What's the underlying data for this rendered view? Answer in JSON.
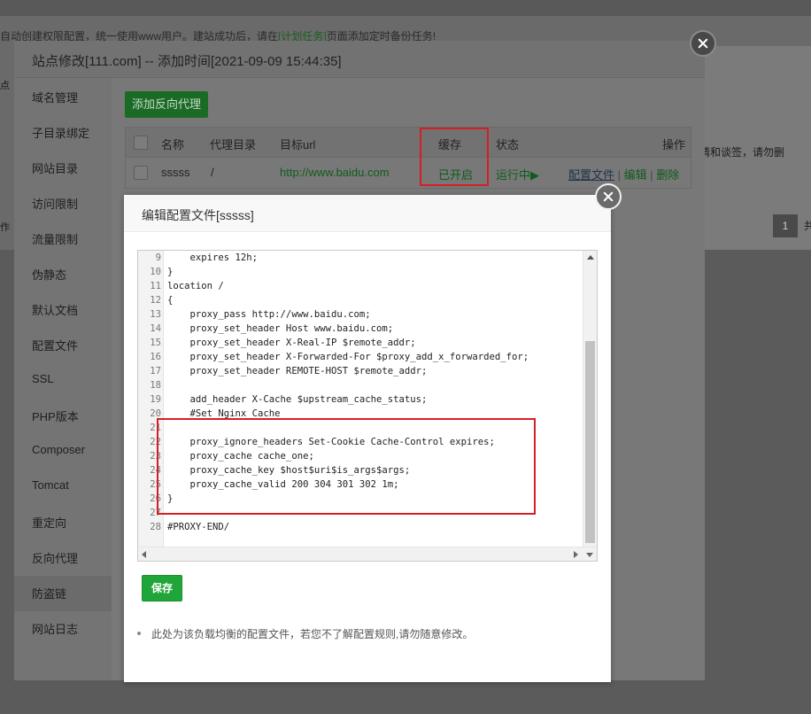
{
  "background": {
    "notice_prefix": "自动创建权限配置，统一使用www用户。建站成功后，请在",
    "notice_link": "[计划任务]",
    "notice_suffix": "页面添加定时备份任务!",
    "left_frag_1": "点",
    "left_frag_2": "作",
    "right_text": "请和谈签，请勿删",
    "page_number": "1",
    "page_total": "共"
  },
  "site_window": {
    "title": "站点修改[111.com] -- 添加时间[2021-09-09 15:44:35]",
    "sidebar": [
      "域名管理",
      "子目录绑定",
      "网站目录",
      "访问限制",
      "流量限制",
      "伪静态",
      "默认文档",
      "配置文件",
      "SSL",
      "PHP版本",
      "Composer",
      "Tomcat",
      "重定向",
      "反向代理",
      "防盗链",
      "网站日志"
    ],
    "active_item": "反向代理",
    "add_button": "添加反向代理",
    "table": {
      "headers": [
        "名称",
        "代理目录",
        "目标url",
        "缓存",
        "状态",
        "操作"
      ],
      "row": {
        "name": "sssss",
        "dir": "/",
        "url": "http://www.baidu.com",
        "cache": "已开启",
        "status": "运行中▶",
        "action_config": "配置文件",
        "action_edit": "编辑",
        "action_delete": "删除",
        "separator": "|"
      }
    }
  },
  "dialog": {
    "title": "编辑配置文件[sssss]",
    "save_button": "保存",
    "tip": "此处为该负载均衡的配置文件，若您不了解配置规则,请勿随意修改。",
    "code": [
      {
        "n": "9",
        "t": "    expires 12h;"
      },
      {
        "n": "10",
        "t": "}"
      },
      {
        "n": "11",
        "t": "location /"
      },
      {
        "n": "12",
        "t": "{"
      },
      {
        "n": "13",
        "t": "    proxy_pass http://www.baidu.com;"
      },
      {
        "n": "14",
        "t": "    proxy_set_header Host www.baidu.com;"
      },
      {
        "n": "15",
        "t": "    proxy_set_header X-Real-IP $remote_addr;"
      },
      {
        "n": "16",
        "t": "    proxy_set_header X-Forwarded-For $proxy_add_x_forwarded_for;"
      },
      {
        "n": "17",
        "t": "    proxy_set_header REMOTE-HOST $remote_addr;"
      },
      {
        "n": "18",
        "t": ""
      },
      {
        "n": "19",
        "t": "    add_header X-Cache $upstream_cache_status;"
      },
      {
        "n": "20",
        "t": "    #Set Nginx Cache"
      },
      {
        "n": "21",
        "t": ""
      },
      {
        "n": "22",
        "t": "    proxy_ignore_headers Set-Cookie Cache-Control expires;"
      },
      {
        "n": "23",
        "t": "    proxy_cache cache_one;"
      },
      {
        "n": "24",
        "t": "    proxy_cache_key $host$uri$is_args$args;"
      },
      {
        "n": "25",
        "t": "    proxy_cache_valid 200 304 301 302 1m;"
      },
      {
        "n": "26",
        "t": "}"
      },
      {
        "n": "27",
        "t": ""
      },
      {
        "n": "28",
        "t": "#PROXY-END/"
      }
    ]
  },
  "colors": {
    "accent_green": "#20a53a",
    "highlight_red": "#d51f26"
  }
}
